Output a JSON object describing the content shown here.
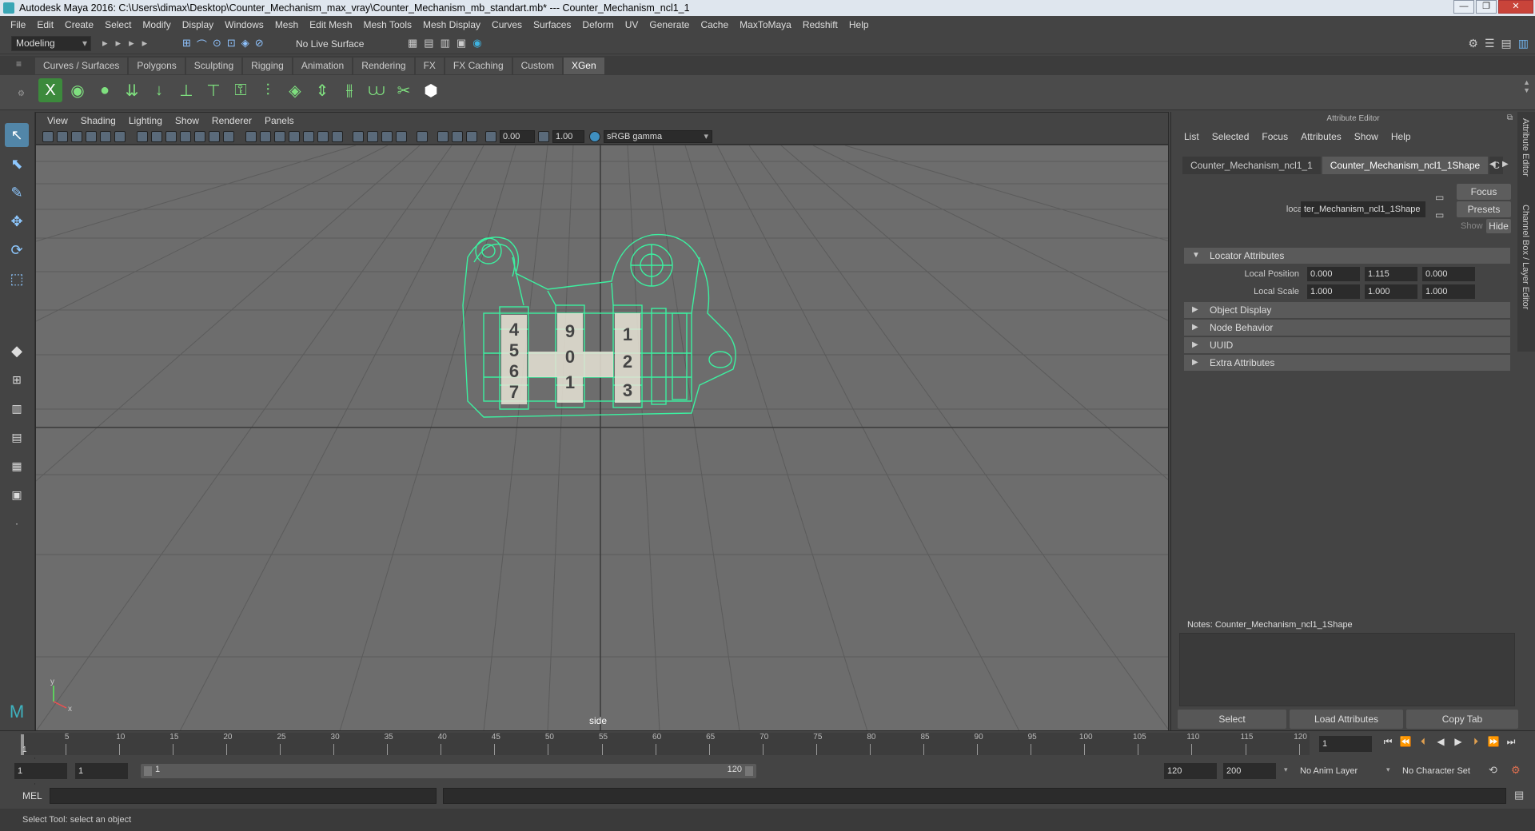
{
  "window": {
    "title": "Autodesk Maya 2016: C:\\Users\\dimax\\Desktop\\Counter_Mechanism_max_vray\\Counter_Mechanism_mb_standart.mb*   ---   Counter_Mechanism_ncl1_1",
    "min": "—",
    "max": "❐",
    "close": "✕"
  },
  "menu": [
    "File",
    "Edit",
    "Create",
    "Select",
    "Modify",
    "Display",
    "Windows",
    "Mesh",
    "Edit Mesh",
    "Mesh Tools",
    "Mesh Display",
    "Curves",
    "Surfaces",
    "Deform",
    "UV",
    "Generate",
    "Cache",
    "MaxToMaya",
    "Redshift",
    "Help"
  ],
  "status": {
    "mode": "Modeling",
    "live_surface": "No Live Surface"
  },
  "shelf_tabs": [
    "Curves / Surfaces",
    "Polygons",
    "Sculpting",
    "Rigging",
    "Animation",
    "Rendering",
    "FX",
    "FX Caching",
    "Custom",
    "XGen"
  ],
  "active_shelf_tab": "XGen",
  "viewport": {
    "menu": [
      "View",
      "Shading",
      "Lighting",
      "Show",
      "Renderer",
      "Panels"
    ],
    "exposure": "0.00",
    "gamma": "1.00",
    "colorspace": "sRGB gamma",
    "camera": "side",
    "digits": {
      "col1": [
        "4",
        "5",
        "6",
        "7"
      ],
      "col2": [
        "9",
        "0",
        "1"
      ],
      "col3": [
        "1",
        "2",
        "3"
      ]
    },
    "axis": {
      "x": "x",
      "y": "y",
      "z": "z"
    }
  },
  "attribute_editor": {
    "header": "Attribute Editor",
    "menu": [
      "List",
      "Selected",
      "Focus",
      "Attributes",
      "Show",
      "Help"
    ],
    "tabs": [
      "Counter_Mechanism_ncl1_1",
      "Counter_Mechanism_ncl1_1Shape",
      "C"
    ],
    "locator_label": "locator:",
    "locator_value": "ter_Mechanism_ncl1_1Shape",
    "focus": "Focus",
    "presets": "Presets",
    "show": "Show",
    "hide": "Hide",
    "sections": {
      "locator": "Locator Attributes",
      "object_display": "Object Display",
      "node_behavior": "Node Behavior",
      "uuid": "UUID",
      "extra": "Extra Attributes"
    },
    "local_position_label": "Local Position",
    "local_position": [
      "0.000",
      "1.115",
      "0.000"
    ],
    "local_scale_label": "Local Scale",
    "local_scale": [
      "1.000",
      "1.000",
      "1.000"
    ],
    "notes": "Notes:  Counter_Mechanism_ncl1_1Shape",
    "buttons": {
      "select": "Select",
      "load": "Load Attributes",
      "copy": "Copy Tab"
    },
    "side_tabs": [
      "Attribute Editor",
      "Channel Box / Layer Editor"
    ]
  },
  "timeline": {
    "ticks": [
      "5",
      "10",
      "15",
      "20",
      "25",
      "30",
      "35",
      "40",
      "45",
      "50",
      "55",
      "60",
      "65",
      "70",
      "75",
      "80",
      "85",
      "90",
      "95",
      "100",
      "105",
      "110",
      "115",
      "120"
    ],
    "start_label": "1",
    "current_frame": "1"
  },
  "range": {
    "start": "1",
    "playback_start": "1",
    "slider_start": "1",
    "slider_end": "120",
    "playback_end": "120",
    "end": "200",
    "anim_layer": "No Anim Layer",
    "char_set": "No Character Set"
  },
  "cmd": {
    "label": "MEL"
  },
  "help": "Select Tool: select an object"
}
